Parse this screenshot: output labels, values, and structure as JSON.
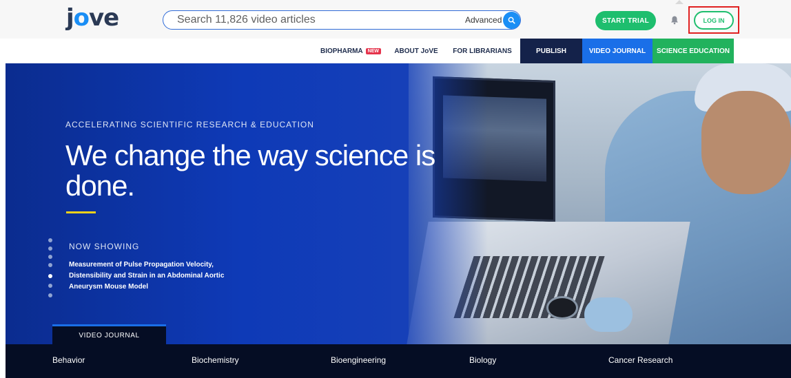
{
  "header": {
    "logo_text": "jove",
    "search": {
      "placeholder": "Search 11,826 video articles",
      "advanced_label": "Advanced"
    },
    "start_trial_label": "START TRIAL",
    "login_label": "LOG IN"
  },
  "nav": {
    "items": [
      {
        "label": "BIOPHARMA",
        "badge": "NEW"
      },
      {
        "label": "ABOUT JoVE"
      },
      {
        "label": "FOR LIBRARIANS"
      },
      {
        "label": "PUBLISH"
      },
      {
        "label": "VIDEO JOURNAL"
      },
      {
        "label": "SCIENCE EDUCATION"
      }
    ]
  },
  "hero": {
    "kicker": "ACCELERATING SCIENTIFIC RESEARCH & EDUCATION",
    "headline": "We change the way science is done.",
    "now_showing_label": "NOW SHOWING",
    "now_showing_title": "Measurement of Pulse Propagation Velocity, Distensibility and Strain in an Abdominal Aortic Aneurysm Mouse Model",
    "active_tab": "VIDEO JOURNAL",
    "slide_count": 7,
    "active_slide": 5
  },
  "categories": [
    "Behavior",
    "Biochemistry",
    "Bioengineering",
    "Biology",
    "Cancer Research"
  ],
  "colors": {
    "brand_blue": "#1a8ef5",
    "green": "#1ebe6e",
    "navy": "#14224a",
    "hero_blue": "#0e3ab7",
    "highlight_red": "#e02020"
  }
}
